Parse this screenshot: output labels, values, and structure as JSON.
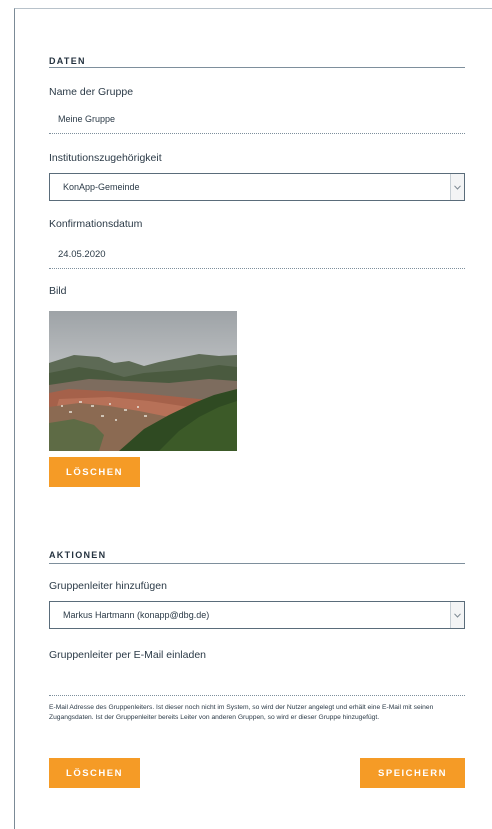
{
  "daten": {
    "section_title": "DATEN",
    "group_name_label": "Name der Gruppe",
    "group_name_value": "Meine Gruppe",
    "institution_label": "Institutionszugehörigkeit",
    "institution_value": "KonApp-Gemeinde",
    "date_label": "Konfirmationsdatum",
    "date_value": "24.05.2020",
    "image_label": "Bild",
    "image_delete_button": "LÖSCHEN"
  },
  "aktionen": {
    "section_title": "AKTIONEN",
    "leader_add_label": "Gruppenleiter hinzufügen",
    "leader_add_value": "Markus Hartmann (konapp@dbg.de)",
    "invite_label": "Gruppenleiter per E-Mail einladen",
    "invite_email_value": "",
    "help_text": "E-Mail Adresse des Gruppenleiters. Ist dieser noch nicht im System, so wird der Nutzer angelegt und erhält eine E-Mail mit seinen Zugangsdaten. Ist der Gruppenleiter bereits Leiter von anderen Gruppen, so wird er dieser Gruppe hinzugefügt.",
    "delete_button": "LÖSCHEN",
    "save_button": "SPEICHERN"
  },
  "icons": {
    "dropdown": "chevron-down-icon"
  },
  "colors": {
    "accent": "#f59b26",
    "text": "#2b3a47",
    "rule": "#7e8f9c"
  }
}
